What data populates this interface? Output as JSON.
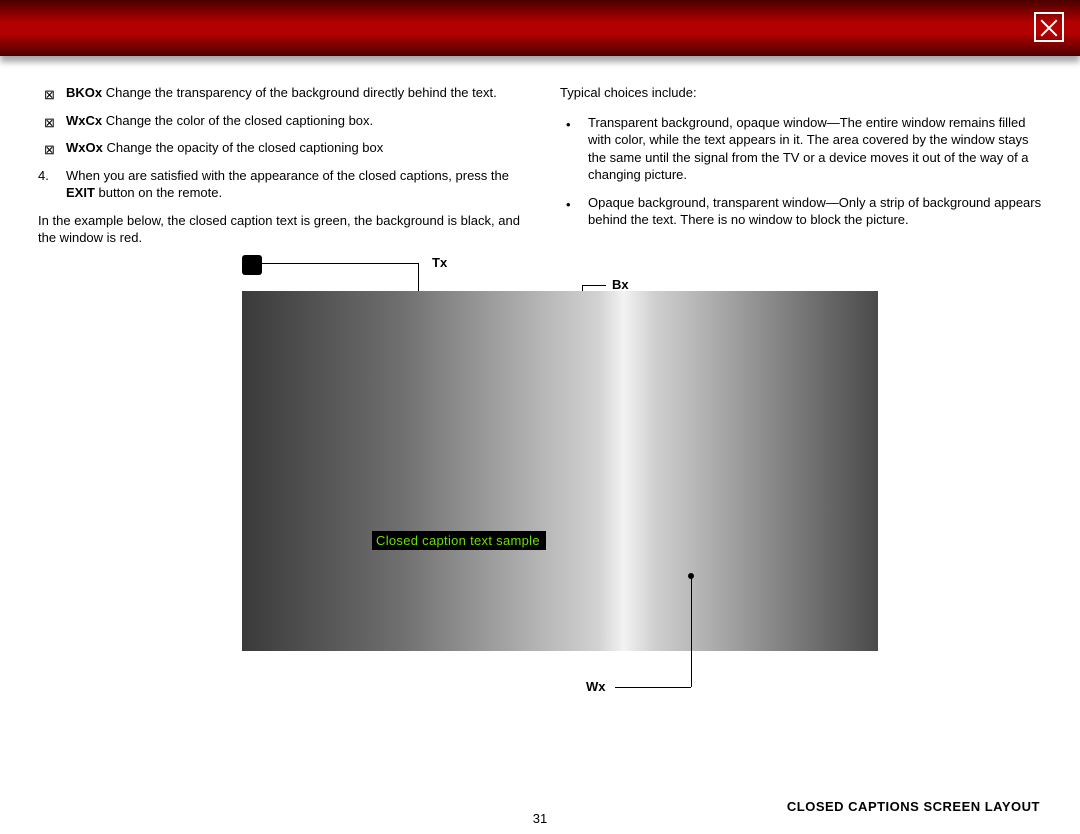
{
  "left": {
    "bullets": [
      {
        "term": "BKOx",
        "desc": " Change the transparency of the background directly behind the text."
      },
      {
        "term": "WxCx",
        "desc": " Change the color of the closed captioning box."
      },
      {
        "term": "WxOx",
        "desc": " Change the opacity of the closed captioning box"
      }
    ],
    "step_num": "4.",
    "step_text_a": "When you are satisfied with the appearance of the closed captions, press the ",
    "step_bold": "EXIT",
    "step_text_b": " button on the remote.",
    "example_para": "In the example below, the closed caption text is green, the background is black, and the window is red."
  },
  "right": {
    "intro": "Typical choices include:",
    "items": [
      "Transparent background, opaque window—The entire window remains filled with color, while the text appears in it. The area covered by the window stays the same until the signal from the TV or a device moves it out of the way of a changing picture.",
      "Opaque background, transparent window—Only a strip of background appears behind the text. There is no window to block the picture."
    ]
  },
  "diagram": {
    "label_tx": "Tx",
    "label_bx": "Bx",
    "label_wx": "Wx",
    "cc_sample": "Closed caption text sample"
  },
  "footer": {
    "label": "CLOSED CAPTIONS SCREEN LAYOUT",
    "page": "31"
  }
}
